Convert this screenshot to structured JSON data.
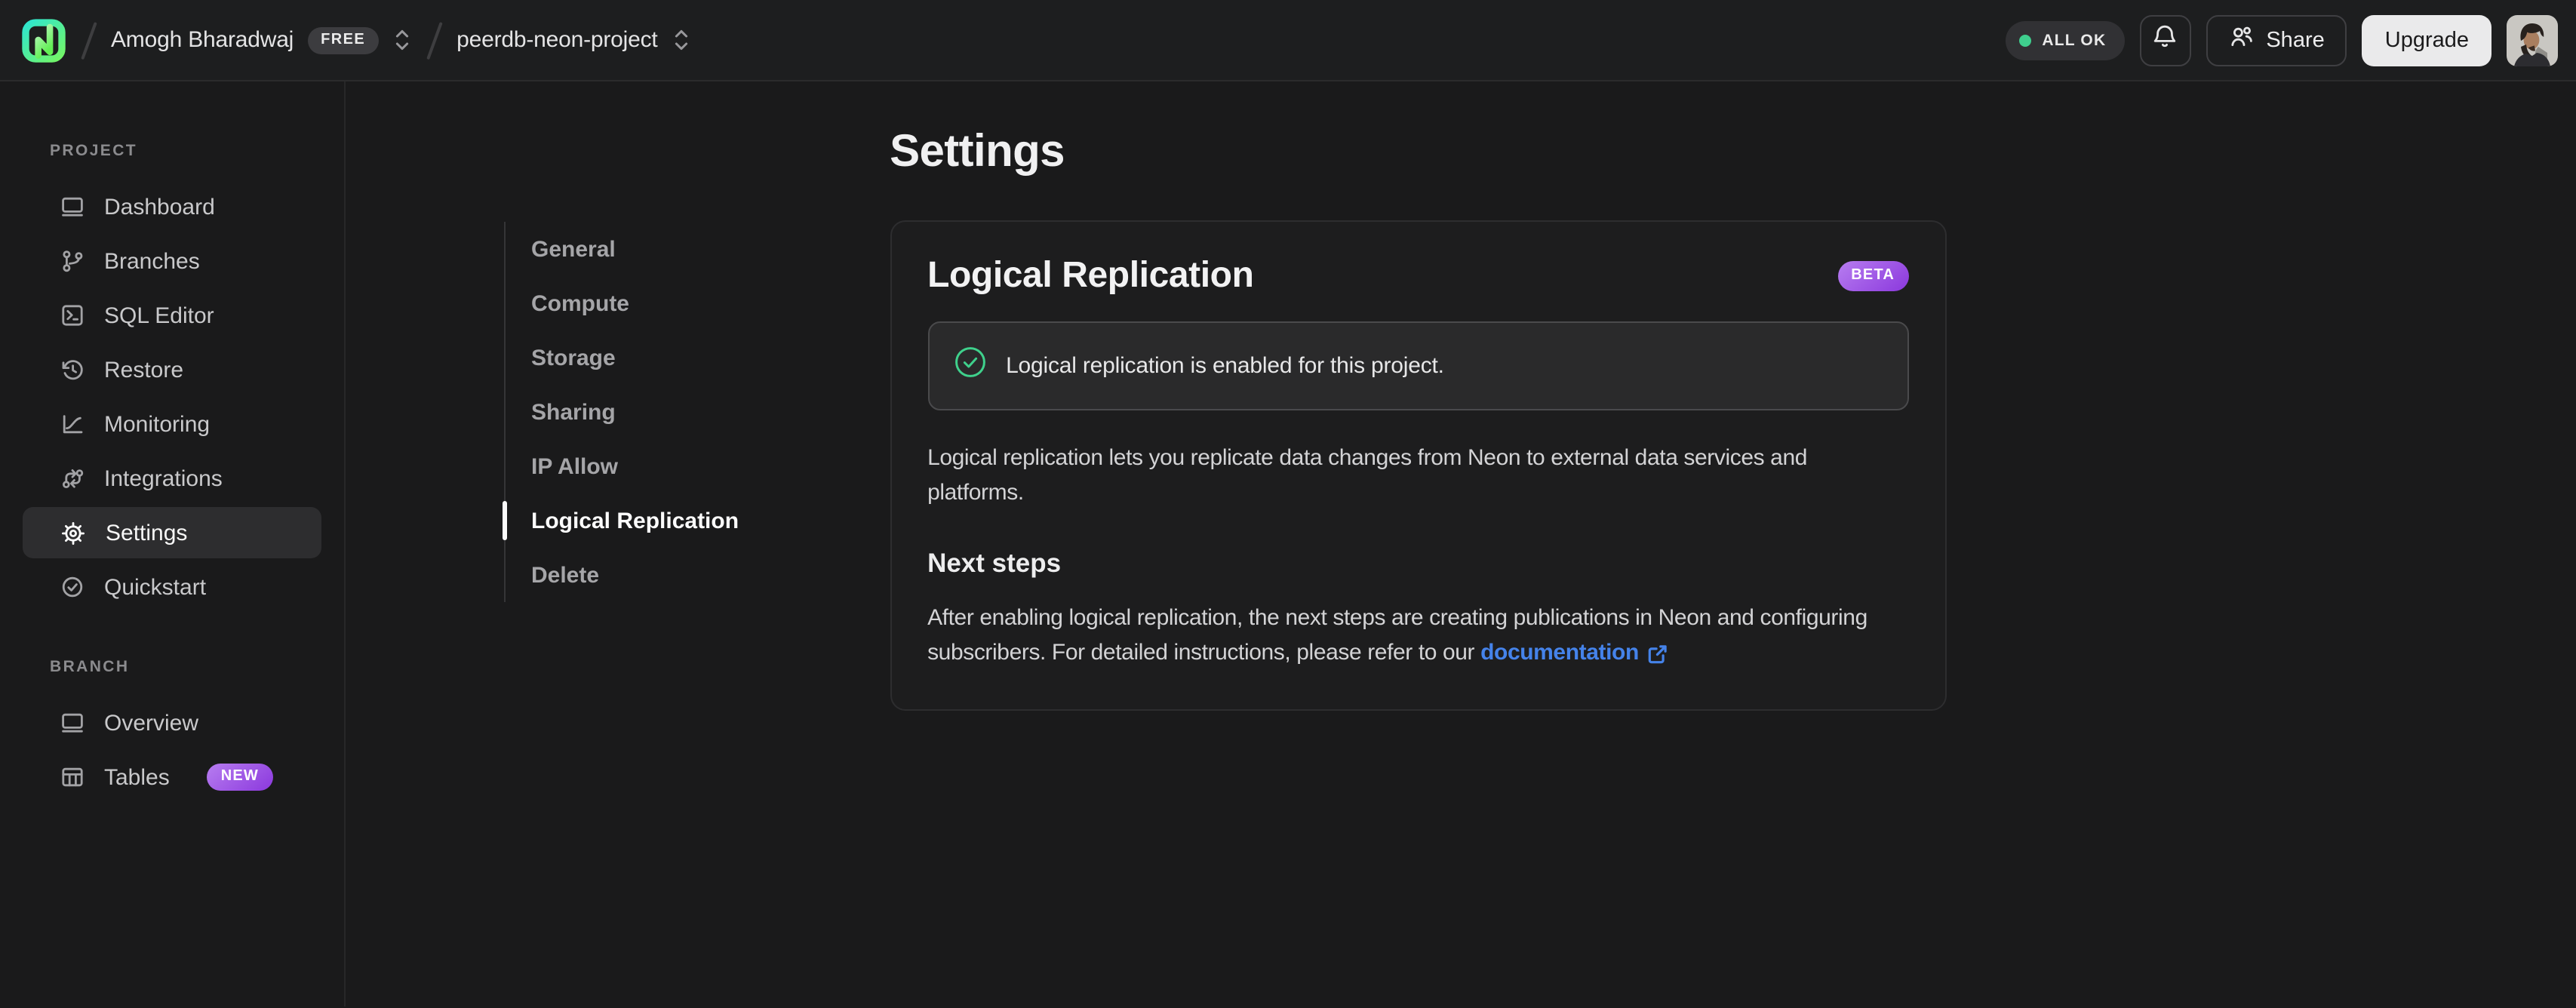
{
  "topbar": {
    "org_name": "Amogh Bharadwaj",
    "org_plan_badge": "FREE",
    "project_name": "peerdb-neon-project",
    "status_label": "ALL OK",
    "share_label": "Share",
    "upgrade_label": "Upgrade"
  },
  "sidebar": {
    "sections": [
      {
        "label": "PROJECT",
        "items": [
          {
            "label": "Dashboard",
            "icon": "window-icon",
            "active": false
          },
          {
            "label": "Branches",
            "icon": "git-branch-icon",
            "active": false
          },
          {
            "label": "SQL Editor",
            "icon": "terminal-icon",
            "active": false
          },
          {
            "label": "Restore",
            "icon": "history-icon",
            "active": false
          },
          {
            "label": "Monitoring",
            "icon": "chart-icon",
            "active": false
          },
          {
            "label": "Integrations",
            "icon": "integrations-icon",
            "active": false
          },
          {
            "label": "Settings",
            "icon": "gear-icon",
            "active": true
          },
          {
            "label": "Quickstart",
            "icon": "check-circle-icon",
            "active": false
          }
        ]
      },
      {
        "label": "BRANCH",
        "items": [
          {
            "label": "Overview",
            "icon": "window-icon",
            "active": false
          },
          {
            "label": "Tables",
            "icon": "table-icon",
            "active": false,
            "badge": "NEW"
          }
        ]
      }
    ]
  },
  "settings_nav": {
    "items": [
      {
        "label": "General",
        "active": false
      },
      {
        "label": "Compute",
        "active": false
      },
      {
        "label": "Storage",
        "active": false
      },
      {
        "label": "Sharing",
        "active": false
      },
      {
        "label": "IP Allow",
        "active": false
      },
      {
        "label": "Logical Replication",
        "active": true
      },
      {
        "label": "Delete",
        "active": false
      }
    ]
  },
  "main": {
    "page_title": "Settings",
    "card": {
      "title": "Logical Replication",
      "beta_badge": "BETA",
      "alert_text": "Logical replication is enabled for this project.",
      "description": "Logical replication lets you replicate data changes from Neon to external data services and platforms.",
      "next_steps_title": "Next steps",
      "next_steps_text": "After enabling logical replication, the next steps are creating publications in Neon and configuring subscribers. For detailed instructions, please refer to our",
      "doc_link_label": "documentation"
    }
  },
  "colors": {
    "accent_green": "#3fcf8e",
    "badge_purple_start": "#b77df0",
    "badge_purple_end": "#8b38dd",
    "link_blue": "#4583ea",
    "logo_gradient_start": "#2ee5cf",
    "logo_gradient_end": "#71f56a"
  }
}
